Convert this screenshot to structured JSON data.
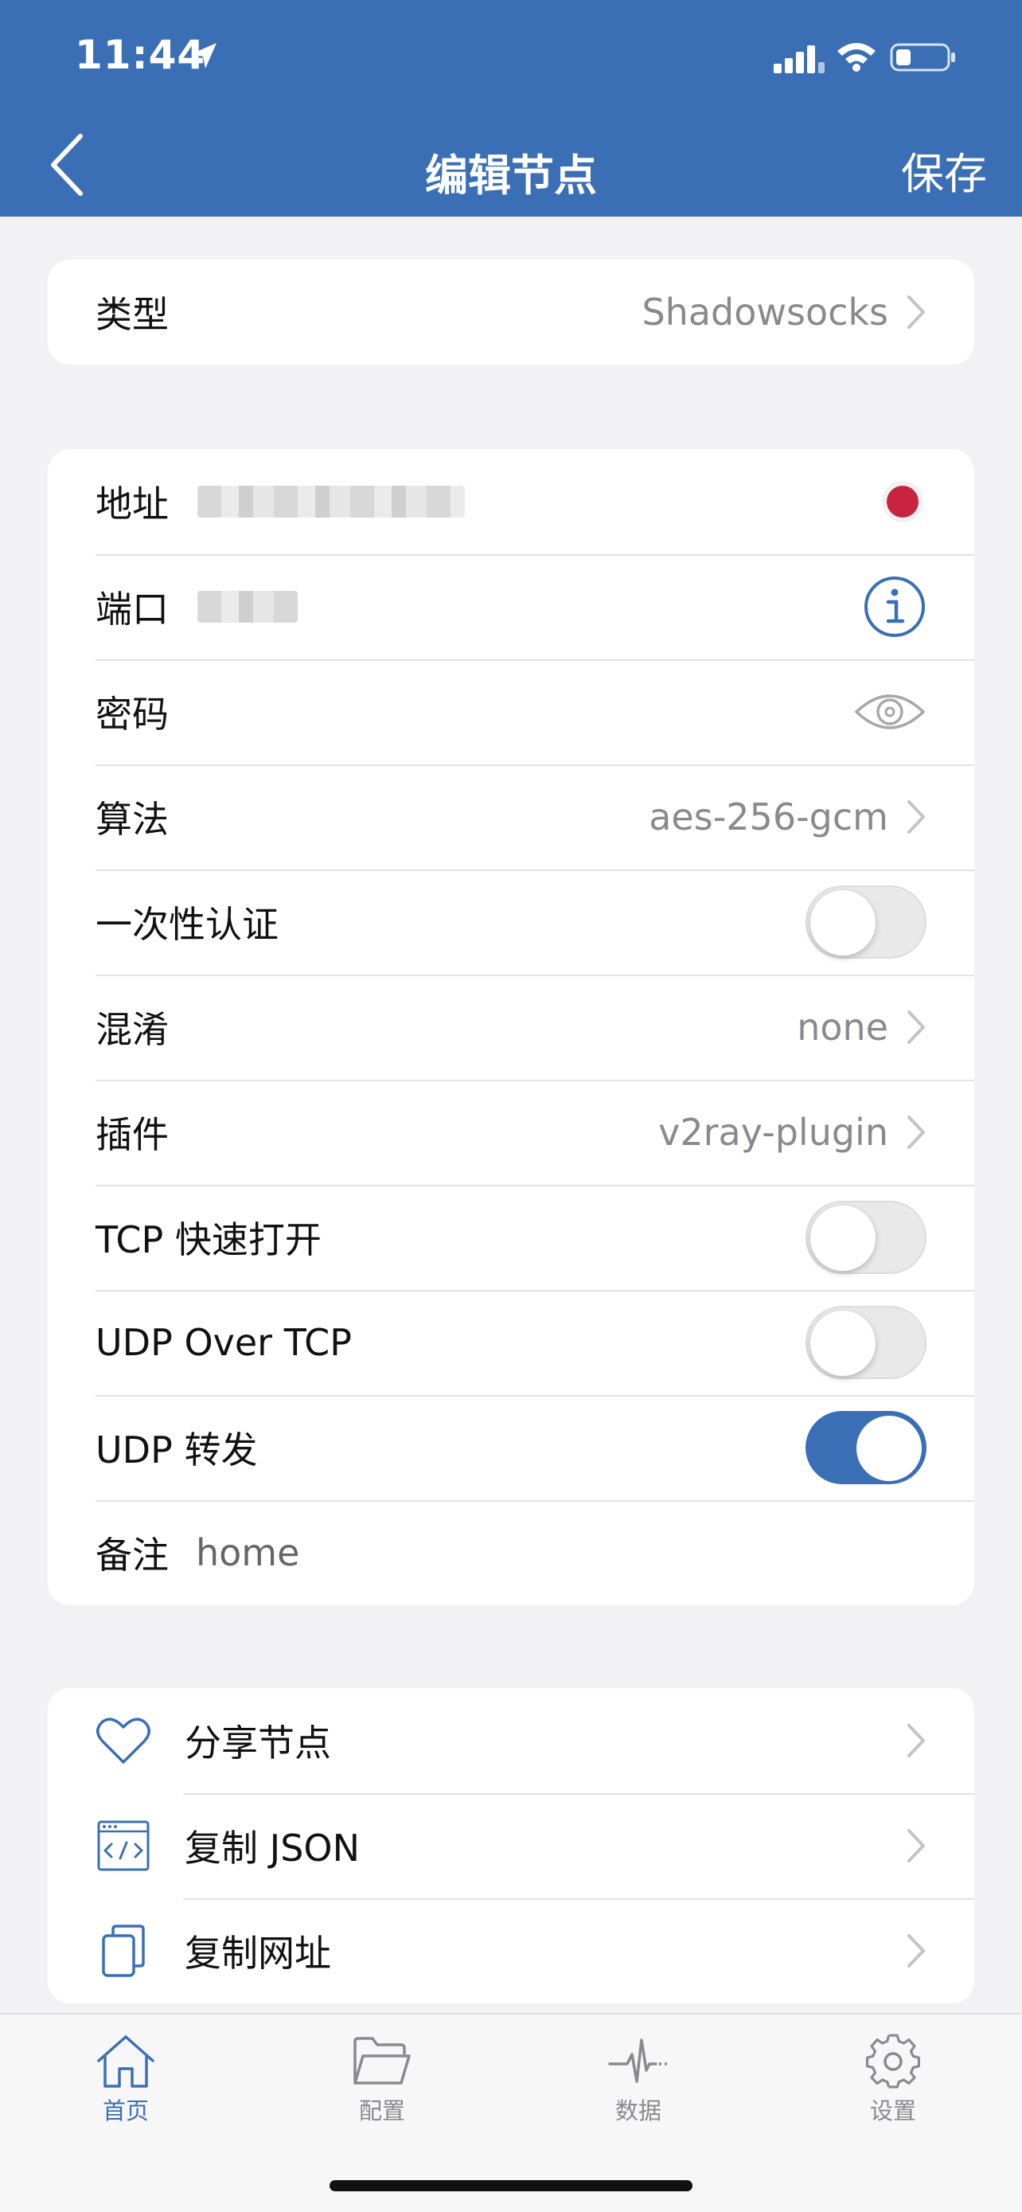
{
  "status_bar": {
    "time": "11:44"
  },
  "nav": {
    "title": "编辑节点",
    "save_label": "保存"
  },
  "type_row": {
    "label": "类型",
    "value": "Shadowsocks"
  },
  "fields": {
    "address_label": "地址",
    "port_label": "端口",
    "password_label": "密码",
    "cipher_label": "算法",
    "cipher_value": "aes-256-gcm",
    "ota_label": "一次性认证",
    "ota_enabled": false,
    "obfs_label": "混淆",
    "obfs_value": "none",
    "plugin_label": "插件",
    "plugin_value": "v2ray-plugin",
    "tfo_label": "TCP 快速打开",
    "tfo_enabled": false,
    "uot_label": "UDP Over TCP",
    "uot_enabled": false,
    "udp_relay_label": "UDP 转发",
    "udp_relay_enabled": true,
    "note_label": "备注",
    "note_value": "home"
  },
  "actions": [
    {
      "label": "分享节点",
      "icon": "heart-icon"
    },
    {
      "label": "复制 JSON",
      "icon": "code-window-icon"
    },
    {
      "label": "复制网址",
      "icon": "copy-icon"
    }
  ],
  "tabs": [
    {
      "label": "首页",
      "icon": "home-icon",
      "active": true
    },
    {
      "label": "配置",
      "icon": "folder-icon",
      "active": false
    },
    {
      "label": "数据",
      "icon": "pulse-icon",
      "active": false
    },
    {
      "label": "设置",
      "icon": "gear-icon",
      "active": false
    }
  ],
  "colors": {
    "accent": "#3b6fb5",
    "status_dot": "#c8243f",
    "background": "#f2f2f4"
  }
}
